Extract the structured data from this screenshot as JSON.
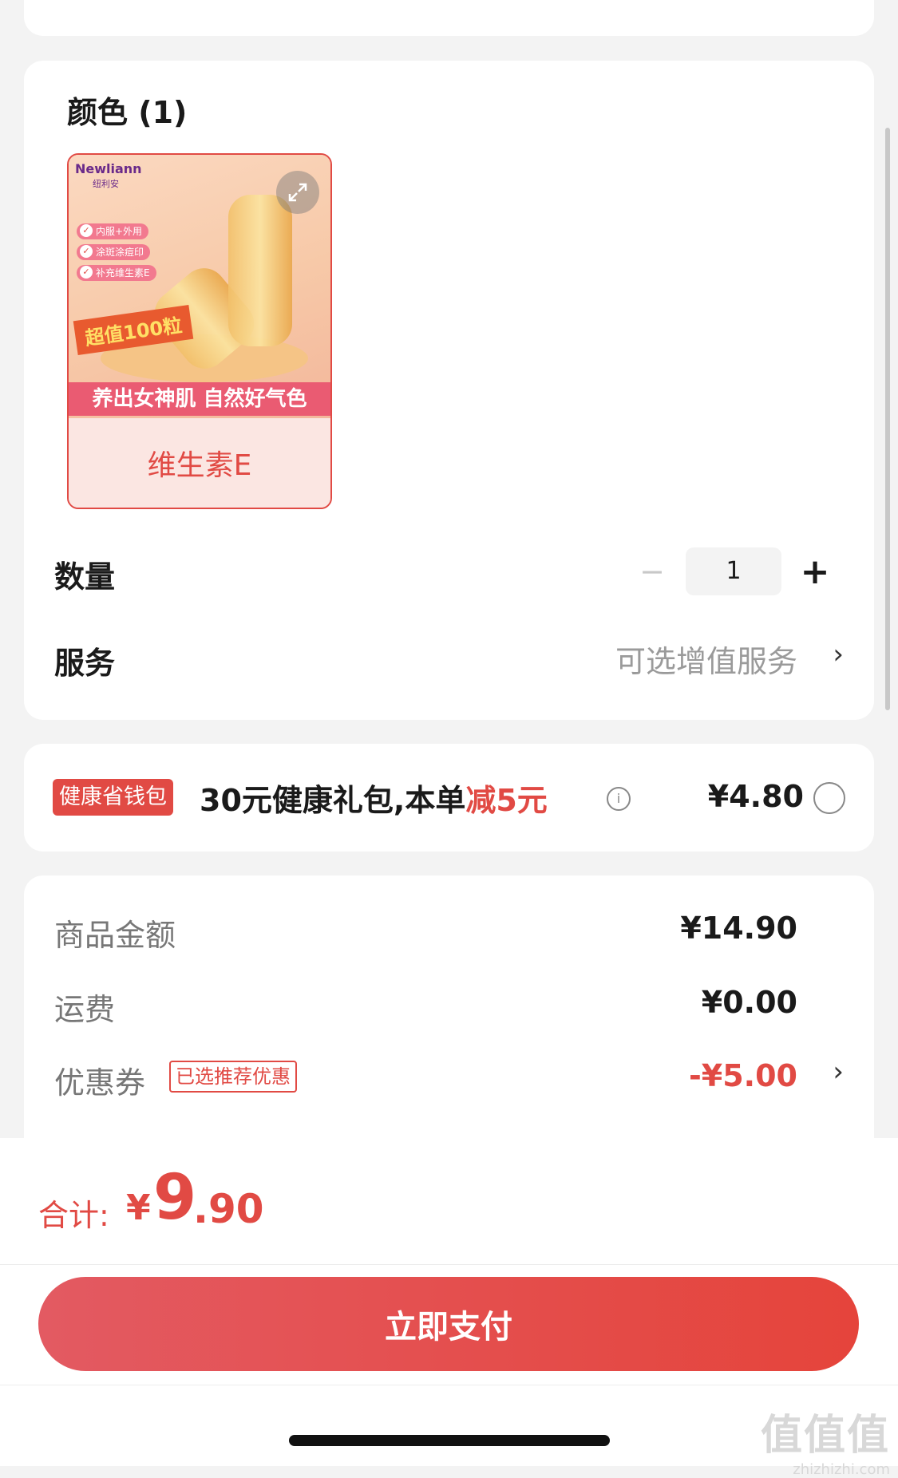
{
  "spec": {
    "section_title": "颜色 (1)",
    "variant": {
      "label": "维生素E",
      "brand": "Newliann",
      "brand_sub": "纽利安",
      "features": [
        "内服+外用",
        "涂斑涂痘印",
        "补充维生素E"
      ],
      "value_tag": "超值100粒",
      "slogan": "养出女神肌 自然好气色"
    },
    "quantity_label": "数量",
    "quantity_value": "1",
    "minus_symbol": "−",
    "plus_symbol": "+",
    "service_label": "服务",
    "service_value": "可选增值服务"
  },
  "promo": {
    "badge": "健康省钱包",
    "text_prefix": "30元健康礼包,本单",
    "text_highlight": "减5元",
    "info_symbol": "i",
    "price": "¥4.80"
  },
  "summary": {
    "goods_label": "商品金额",
    "goods_value": "¥14.90",
    "shipping_label": "运费",
    "shipping_value": "¥0.00",
    "coupon_label": "优惠券",
    "coupon_tag": "已选推荐优惠",
    "coupon_value": "-¥5.00"
  },
  "footer": {
    "total_label": "合计:",
    "currency": "¥",
    "total_int": "9",
    "total_dec": ".90",
    "pay_button": "立即支付"
  },
  "watermark": {
    "big": "值值值",
    "small": "zhizhizhi.com"
  },
  "icons": {
    "chevron": "chevron-right-icon",
    "expand": "expand-icon",
    "info": "info-icon"
  },
  "colors": {
    "accent": "#e14a44",
    "background": "#f3f3f3"
  }
}
